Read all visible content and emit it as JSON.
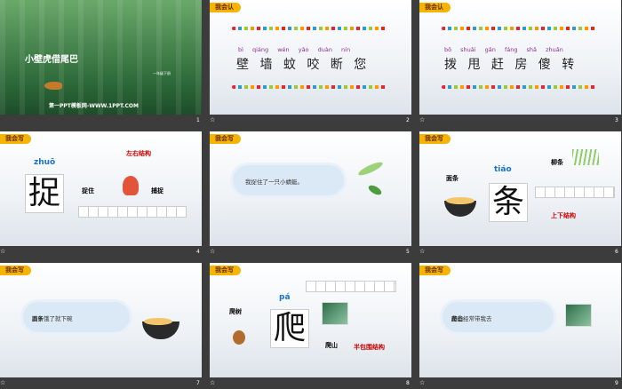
{
  "slides": [
    {
      "num": "1",
      "title": "小壁虎借尾巴",
      "footer": "第一PPT模板网-WWW.1PPT.COM",
      "caption": "一年级下册"
    },
    {
      "num": "2",
      "tab": "我会认",
      "pinyin": "bì qiáng wén yǎo duàn nín",
      "chars": "壁 墙 蚊 咬 断 您"
    },
    {
      "num": "3",
      "tab": "我会认",
      "pinyin": "bō shuǎi gǎn fáng shǎ zhuǎn",
      "chars": "拨 甩 赶 房 傻 转"
    },
    {
      "num": "4",
      "tab": "我会写",
      "pinyin": "zhuō",
      "char": "捉",
      "structure": "左右结构",
      "word1": "捉住",
      "word2": "捕捉"
    },
    {
      "num": "5",
      "tab": "我会写",
      "sentence": "我捉住了一只小蜻蜓。"
    },
    {
      "num": "6",
      "tab": "我会写",
      "pinyin": "tiáo",
      "char": "条",
      "structure": "上下结构",
      "word1": "面条",
      "word2": "柳条"
    },
    {
      "num": "7",
      "tab": "我会写",
      "sentence_pre": "肚子饿了就下碗",
      "sentence_hl": "面条",
      "sentence_end": "。"
    },
    {
      "num": "8",
      "tab": "我会写",
      "pinyin": "pá",
      "char": "爬",
      "structure": "半包围结构",
      "word1": "爬树",
      "word2": "爬山"
    },
    {
      "num": "9",
      "tab": "我会写",
      "sentence_pre": "爸爸经常带我去",
      "sentence_hl": "爬山",
      "sentence_end": "。"
    }
  ],
  "marker": "☆"
}
